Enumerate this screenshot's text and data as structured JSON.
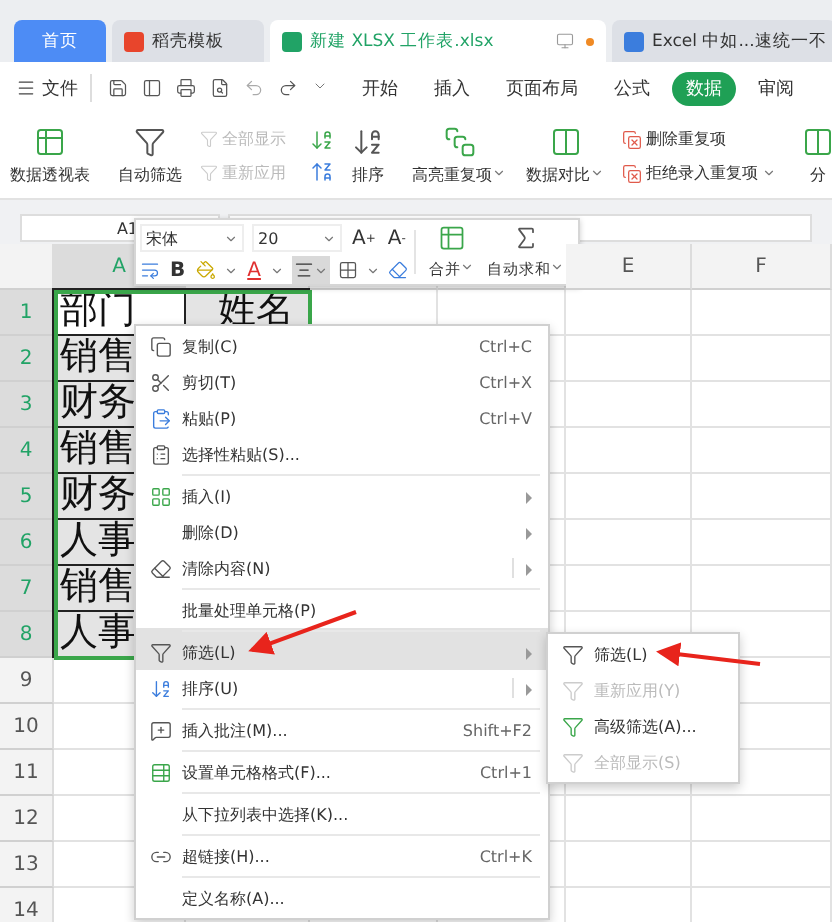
{
  "tabs": [
    {
      "label": "首页",
      "selected": false,
      "kind": "home"
    },
    {
      "label": "稻壳模板",
      "selected": false,
      "kind": "docer"
    },
    {
      "label": "新建 XLSX 工作表.xlsx",
      "selected": true,
      "kind": "sheet"
    },
    {
      "label": "Excel 中如...速统一不",
      "selected": false,
      "kind": "doc"
    }
  ],
  "menu_bar": {
    "file": "文件",
    "items": [
      {
        "label": "开始",
        "selected": false
      },
      {
        "label": "插入",
        "selected": false
      },
      {
        "label": "页面布局",
        "selected": false
      },
      {
        "label": "公式",
        "selected": false
      },
      {
        "label": "数据",
        "selected": true
      },
      {
        "label": "审阅",
        "selected": false
      }
    ]
  },
  "ribbon": {
    "pivot": "数据透视表",
    "autofilter": "自动筛选",
    "show_all": {
      "label": "全部显示",
      "disabled": true
    },
    "reapply": {
      "label": "重新应用",
      "disabled": true
    },
    "sort": "排序",
    "highlight": "高亮重复项",
    "compare": "数据对比",
    "remove_dup": "删除重复项",
    "reject_dup": "拒绝录入重复项",
    "split": "分"
  },
  "name_box": "A1",
  "mini_toolbar": {
    "font": "宋体",
    "size": "20",
    "grow": "A",
    "grow_sign": "+",
    "shrink": "A",
    "shrink_sign": "-",
    "bold": "B",
    "font_color": "A",
    "merge": "合并",
    "autosum": "自动求和"
  },
  "sheet": {
    "columns": [
      {
        "label": "A",
        "selected": true
      },
      {
        "label": "E",
        "selected": false
      },
      {
        "label": "F",
        "selected": false
      }
    ],
    "rows": [
      {
        "header": "1",
        "selected": true,
        "cells": [
          {
            "text": "部门",
            "active": true
          },
          {
            "text": "姓名",
            "active": false
          }
        ]
      },
      {
        "header": "2",
        "selected": true,
        "cells": [
          {
            "text": "销售",
            "active": false
          }
        ]
      },
      {
        "header": "3",
        "selected": true,
        "cells": [
          {
            "text": "财务",
            "active": false
          }
        ]
      },
      {
        "header": "4",
        "selected": true,
        "cells": [
          {
            "text": "销售",
            "active": false
          }
        ]
      },
      {
        "header": "5",
        "selected": true,
        "cells": [
          {
            "text": "财务",
            "active": false
          }
        ]
      },
      {
        "header": "6",
        "selected": true,
        "cells": [
          {
            "text": "人事",
            "active": false
          }
        ]
      },
      {
        "header": "7",
        "selected": true,
        "cells": [
          {
            "text": "销售",
            "active": false
          }
        ]
      },
      {
        "header": "8",
        "selected": true,
        "cells": [
          {
            "text": "人事",
            "active": false
          }
        ]
      },
      {
        "header": "9",
        "selected": false,
        "cells": []
      },
      {
        "header": "10",
        "selected": false,
        "cells": []
      },
      {
        "header": "11",
        "selected": false,
        "cells": []
      },
      {
        "header": "12",
        "selected": false,
        "cells": []
      },
      {
        "header": "13",
        "selected": false,
        "cells": []
      },
      {
        "header": "14",
        "selected": false,
        "cells": []
      }
    ]
  },
  "context_menu": [
    {
      "kind": "copy",
      "label": "复制(C)",
      "shortcut": "Ctrl+C",
      "separator_before": false,
      "submenu": false,
      "split": false,
      "selected": false
    },
    {
      "kind": "cut",
      "label": "剪切(T)",
      "shortcut": "Ctrl+X",
      "separator_before": false,
      "submenu": false,
      "split": false,
      "selected": false
    },
    {
      "kind": "paste",
      "label": "粘贴(P)",
      "shortcut": "Ctrl+V",
      "separator_before": false,
      "submenu": false,
      "split": false,
      "selected": false
    },
    {
      "kind": "paste-special",
      "label": "选择性粘贴(S)...",
      "separator_before": false,
      "submenu": false,
      "split": false,
      "selected": false
    },
    {
      "kind": "insert",
      "label": "插入(I)",
      "separator_before": true,
      "submenu": true,
      "split": false,
      "selected": false
    },
    {
      "kind": "plain",
      "label": "删除(D)",
      "separator_before": false,
      "submenu": true,
      "split": false,
      "selected": false
    },
    {
      "kind": "clear",
      "label": "清除内容(N)",
      "separator_before": false,
      "submenu": true,
      "split": true,
      "selected": false
    },
    {
      "kind": "plain",
      "label": "批量处理单元格(P)",
      "separator_before": true,
      "submenu": false,
      "split": false,
      "selected": false
    },
    {
      "kind": "filter",
      "label": "筛选(L)",
      "separator_before": true,
      "submenu": true,
      "split": false,
      "selected": true
    },
    {
      "kind": "sort",
      "label": "排序(U)",
      "separator_before": false,
      "submenu": true,
      "split": true,
      "selected": false
    },
    {
      "kind": "comment",
      "label": "插入批注(M)...",
      "shortcut": "Shift+F2",
      "separator_before": true,
      "submenu": false,
      "split": false,
      "selected": false
    },
    {
      "kind": "format",
      "label": "设置单元格格式(F)...",
      "shortcut": "Ctrl+1",
      "separator_before": true,
      "submenu": false,
      "split": false,
      "selected": false
    },
    {
      "kind": "plain",
      "label": "从下拉列表中选择(K)...",
      "separator_before": true,
      "submenu": false,
      "split": false,
      "selected": false
    },
    {
      "kind": "link",
      "label": "超链接(H)...",
      "shortcut": "Ctrl+K",
      "separator_before": true,
      "submenu": false,
      "split": false,
      "selected": false
    },
    {
      "kind": "plain",
      "label": "定义名称(A)...",
      "separator_before": true,
      "submenu": false,
      "split": false,
      "selected": false
    }
  ],
  "submenu": [
    {
      "kind": "filter",
      "label": "筛选(L)",
      "disabled": false
    },
    {
      "kind": "reapply",
      "label": "重新应用(Y)",
      "disabled": true
    },
    {
      "kind": "advanced",
      "label": "高级筛选(A)...",
      "disabled": false
    },
    {
      "kind": "show-all",
      "label": "全部显示(S)",
      "disabled": true
    }
  ]
}
